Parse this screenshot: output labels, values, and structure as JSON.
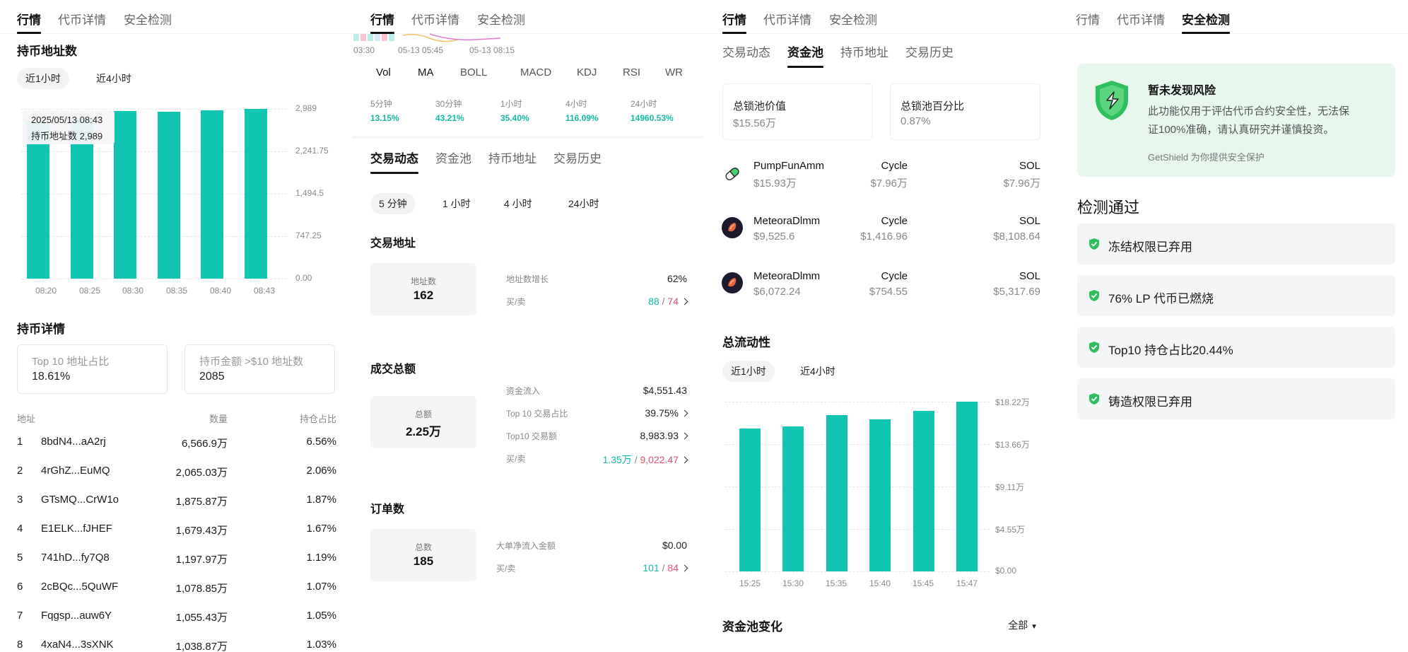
{
  "top_tabs": [
    "行情",
    "代币详情",
    "安全检测"
  ],
  "p1": {
    "holders_title": "持币地址数",
    "time_pills": [
      "近1小时",
      "近4小时"
    ],
    "tooltip_date": "2025/05/13 08:43",
    "tooltip_value": "持币地址数 2,989",
    "y_ticks": [
      "2,989",
      "2,241.75",
      "1,494.5",
      "747.25",
      "0.00"
    ],
    "details_title": "持币详情",
    "stat1_label": "Top 10 地址占比",
    "stat1_value": "18.61%",
    "stat2_label": "持币金额 >$10 地址数",
    "stat2_value": "2085",
    "table_headers": [
      "地址",
      "数量",
      "持仓占比"
    ],
    "rows": [
      {
        "rank": "1",
        "addr": "8bdN4...aA2rj",
        "qty": "6,566.9万",
        "pct": "6.56%"
      },
      {
        "rank": "2",
        "addr": "4rGhZ...EuMQ",
        "qty": "2,065.03万",
        "pct": "2.06%"
      },
      {
        "rank": "3",
        "addr": "GTsMQ...CrW1o",
        "qty": "1,875.87万",
        "pct": "1.87%"
      },
      {
        "rank": "4",
        "addr": "E1ELK...fJHEF",
        "qty": "1,679.43万",
        "pct": "1.67%"
      },
      {
        "rank": "5",
        "addr": "741hD...fy7Q8",
        "qty": "1,197.97万",
        "pct": "1.19%"
      },
      {
        "rank": "6",
        "addr": "2cBQc...5QuWF",
        "qty": "1,078.85万",
        "pct": "1.07%"
      },
      {
        "rank": "7",
        "addr": "Fqgsp...auw6Y",
        "qty": "1,055.43万",
        "pct": "1.05%"
      },
      {
        "rank": "8",
        "addr": "4xaN4...3sXNK",
        "qty": "1,038.87万",
        "pct": "1.03%"
      }
    ]
  },
  "p2": {
    "axis_times": [
      "03:30",
      "05-13 05:45",
      "05-13 08:15"
    ],
    "indicator_tabs": [
      "Vol",
      "MA",
      "BOLL",
      "MACD",
      "KDJ",
      "RSI",
      "WR"
    ],
    "periods": [
      {
        "label": "5分钟",
        "value": "13.15%"
      },
      {
        "label": "30分钟",
        "value": "43.21%"
      },
      {
        "label": "1小时",
        "value": "35.40%"
      },
      {
        "label": "4小时",
        "value": "116.09%"
      },
      {
        "label": "24小时",
        "value": "14960.53%"
      }
    ],
    "sub_tabs": [
      "交易动态",
      "资金池",
      "持币地址",
      "交易历史"
    ],
    "time_pills": [
      "5 分钟",
      "1 小时",
      "4 小时",
      "24小时"
    ],
    "addr_title": "交易地址",
    "addr_box_label": "地址数",
    "addr_box_value": "162",
    "addr_growth_label": "地址数增长",
    "addr_growth_value": "62%",
    "buysell_label": "买/卖",
    "addr_buy": "88",
    "addr_sell": "74",
    "slash": "/",
    "volume_title": "成交总额",
    "volume_box_label": "总额",
    "volume_box_value": "2.25万",
    "inflow_label": "资金流入",
    "inflow_value": "$4,551.43",
    "top10_share_label": "Top 10 交易占比",
    "top10_share_value": "39.75%",
    "top10_amount_label": "Top10  交易额",
    "top10_amount_value": "8,983.93",
    "vol_buy": "1.35万",
    "vol_sell": "9,022.47",
    "orders_title": "订单数",
    "orders_box_label": "总数",
    "orders_box_value": "185",
    "big_inflow_label": "大单净流入金额",
    "big_inflow_value": "$0.00",
    "orders_buy": "101",
    "orders_sell": "84"
  },
  "p3": {
    "sub_tabs": [
      "交易动态",
      "资金池",
      "持币地址",
      "交易历史"
    ],
    "locked_value_label": "总锁池价值",
    "locked_value": "$15.56万",
    "locked_pct_label": "总锁池百分比",
    "locked_pct": "0.87%",
    "pools": [
      {
        "name": "PumpFunAmm",
        "value": "$15.93万",
        "cycle_label": "Cycle",
        "cycle_value": "$7.96万",
        "sol_label": "SOL",
        "sol_value": "$7.96万"
      },
      {
        "name": "MeteoraDlmm",
        "value": "$9,525.6",
        "cycle_label": "Cycle",
        "cycle_value": "$1,416.96",
        "sol_label": "SOL",
        "sol_value": "$8,108.64"
      },
      {
        "name": "MeteoraDlmm",
        "value": "$6,072.24",
        "cycle_label": "Cycle",
        "cycle_value": "$754.55",
        "sol_label": "SOL",
        "sol_value": "$5,317.69"
      }
    ],
    "liquidity_title": "总流动性",
    "time_pills": [
      "近1小时",
      "近4小时"
    ],
    "y_ticks": [
      "$18.22万",
      "$13.66万",
      "$9.11万",
      "$4.55万",
      "$0.00"
    ],
    "pool_change_title": "资金池变化",
    "filter_label": "全部"
  },
  "p4": {
    "risk_title": "暂未发现风险",
    "risk_desc_1": "此功能仅用于评估代币合约安全性，无法保",
    "risk_desc_2": "证100%准确，请认真研究并谨慎投资。",
    "risk_footer": "GetShield 为你提供安全保护",
    "passed_title": "检测通过",
    "checks": [
      "冻结权限已弃用",
      "76% LP 代币已燃烧",
      "Top10 持仓占比20.44%",
      "铸造权限已弃用"
    ]
  },
  "chart_data": [
    {
      "type": "bar",
      "title": "持币地址数",
      "categories": [
        "08:20",
        "08:25",
        "08:30",
        "08:35",
        "08:40",
        "08:43"
      ],
      "values": [
        2760,
        2830,
        2950,
        2940,
        2960,
        2989
      ],
      "ylim": [
        0,
        2989
      ]
    },
    {
      "type": "bar",
      "title": "总流动性",
      "categories": [
        "15:25",
        "15:30",
        "15:35",
        "15:40",
        "15:45",
        "15:47"
      ],
      "values": [
        15.3,
        15.6,
        16.8,
        16.3,
        17.2,
        18.22
      ],
      "ylim": [
        0,
        18.22
      ],
      "ylabel": ""
    }
  ],
  "colors": {
    "teal": "#11c5b3",
    "positive": "#14b8a6",
    "negative": "#e0526f",
    "safe_bg": "#e8f7ee",
    "shield": "#2fbf5e"
  }
}
